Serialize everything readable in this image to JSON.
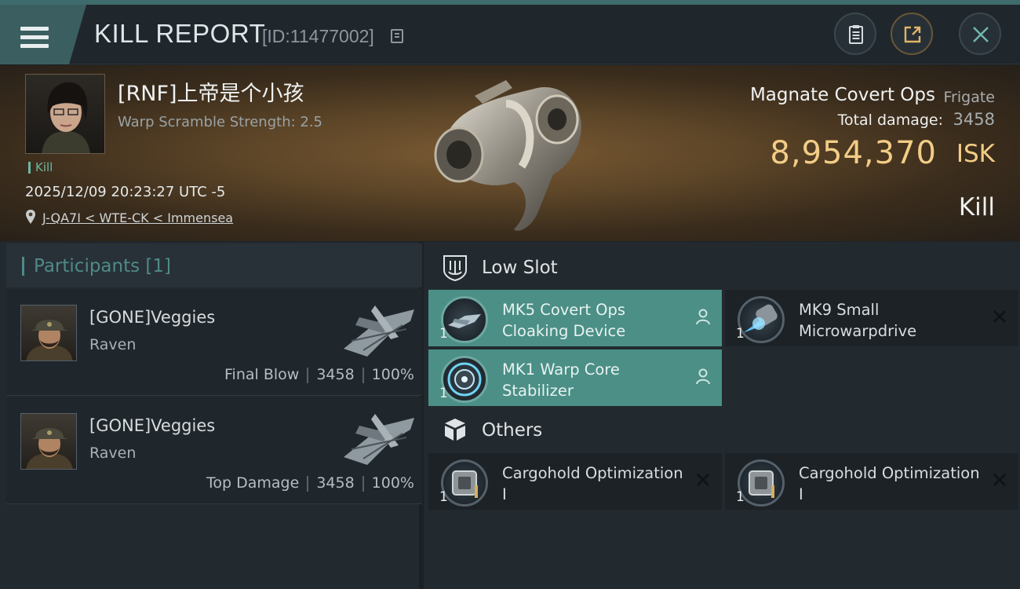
{
  "header": {
    "title": "KILL REPORT",
    "report_id": "[ID:11477002]"
  },
  "victim": {
    "name": "[RNF]上帝是个小孩",
    "warp_strength": "Warp Scramble Strength: 2.5",
    "tag": "Kill",
    "datetime": "2025/12/09 20:23:27 UTC -5",
    "location": "J-QA7I < WTE-CK < Immensea"
  },
  "ship": {
    "name": "Magnate Covert Ops",
    "class": "Frigate",
    "damage_label": "Total damage:",
    "damage_value": "3458",
    "isk_value": "8,954,370",
    "isk_unit": "ISK",
    "result": "Kill"
  },
  "participants": {
    "title": "Participants",
    "count": "[1]",
    "rows": [
      {
        "name": "[GONE]Veggies",
        "ship": "Raven",
        "role": "Final Blow",
        "damage": "3458",
        "percent": "100%"
      },
      {
        "name": "[GONE]Veggies",
        "ship": "Raven",
        "role": "Top Damage",
        "damage": "3458",
        "percent": "100%"
      }
    ]
  },
  "fitting": {
    "low_slot": {
      "title": "Low Slot",
      "modules": [
        {
          "qty": "1",
          "name": "MK5 Covert Ops Cloaking Device",
          "status": "dropped"
        },
        {
          "qty": "1",
          "name": "MK9 Small Microwarpdrive",
          "status": "destroyed"
        },
        {
          "qty": "1",
          "name": "MK1 Warp Core Stabilizer",
          "status": "dropped"
        }
      ]
    },
    "others": {
      "title": "Others",
      "modules": [
        {
          "qty": "1",
          "name": "Cargohold Optimization I",
          "status": "destroyed"
        },
        {
          "qty": "1",
          "name": "Cargohold Optimization I",
          "status": "destroyed"
        }
      ]
    }
  },
  "colors": {
    "accent": "#4b8f86",
    "isk": "#f3cd86",
    "kill_tag": "#6db7a2"
  }
}
